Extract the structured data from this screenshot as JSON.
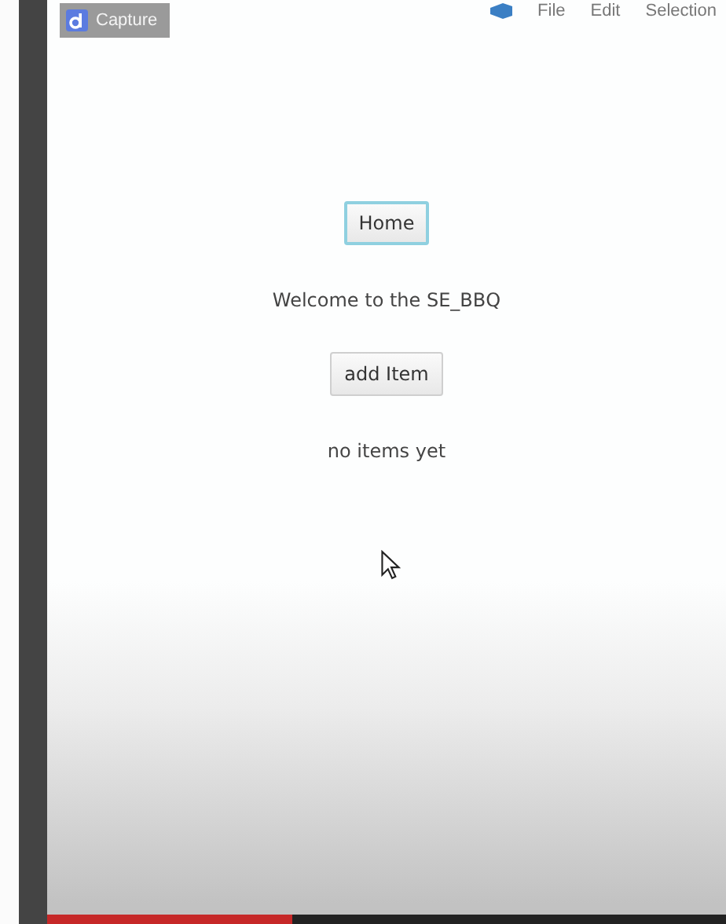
{
  "overlay": {
    "badge": "Capture"
  },
  "menu": [
    "File",
    "Edit",
    "Selection"
  ],
  "app": {
    "home_button": {
      "label": "Home",
      "focused": true
    },
    "welcome": "Welcome to the SE_BBQ",
    "add_button": {
      "label": "add Item",
      "focused": false
    },
    "empty_message": "no items yet"
  },
  "player": {
    "level": 0.36
  }
}
